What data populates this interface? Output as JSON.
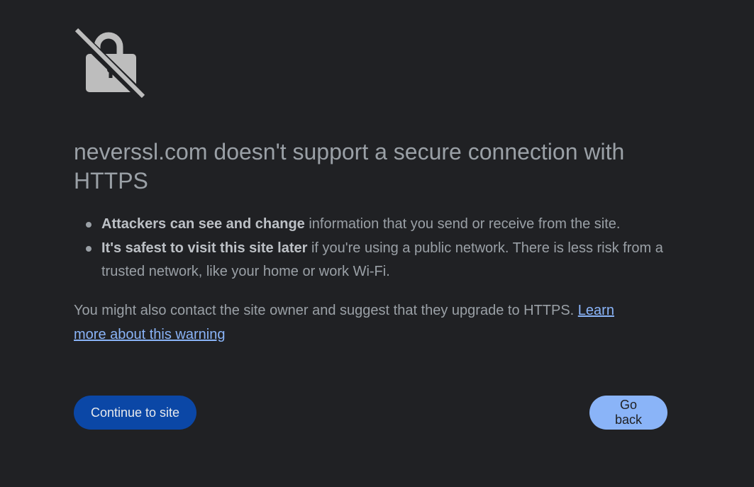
{
  "icon": "unlocked-padlock-crossed-icon",
  "colors": {
    "background": "#202124",
    "text": "#9aa0a6",
    "bold_text": "#bdc1c6",
    "link": "#8ab4f8",
    "primary_button": "#0b47a6",
    "secondary_button": "#8ab4f8"
  },
  "headline": "neverssl.com doesn't support a secure connection with HTTPS",
  "bullets": [
    {
      "bold": "Attackers can see and change",
      "text": " information that you send or receive from the site."
    },
    {
      "bold": "It's safest to visit this site later",
      "text": " if you're using a public network. There is less risk from a trusted network, like your home or work Wi-Fi."
    }
  ],
  "paragraph": {
    "text": "You might also contact the site owner and suggest that they upgrade to HTTPS. ",
    "link_label": "Learn more about this warning"
  },
  "buttons": {
    "continue_label": "Continue to site",
    "back_label": "Go back"
  }
}
